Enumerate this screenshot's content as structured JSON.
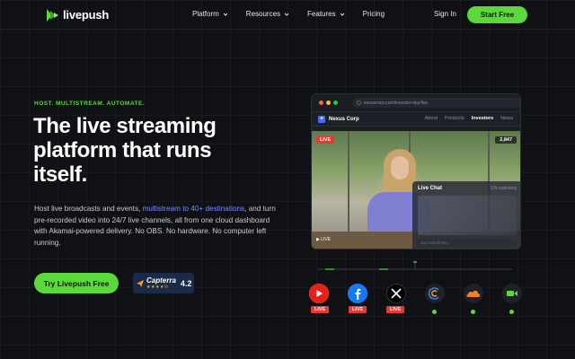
{
  "nav": {
    "logo": "livepush",
    "links": [
      "Platform",
      "Resources",
      "Features",
      "Pricing"
    ],
    "signin": "Sign In",
    "start": "Start Free"
  },
  "hero": {
    "eyebrow": "HOST. MULTISTREAM. AUTOMATE.",
    "headline": "The live streaming platform that runs itself.",
    "desc_pre": "Host live broadcasts and events, ",
    "desc_link": "multistream to 40+ destinations",
    "desc_post": ", and turn pre-recorded video into 24/7 live channels, all from one cloud dashboard with Akamai-powered delivery. No OBS. No hardware. No computer left running.",
    "cta": "Try Livepush Free",
    "capterra_name": "Capterra",
    "capterra_stars": "★★★★½",
    "capterra_score": "4.2"
  },
  "browser": {
    "url": "nexuscorp.com/investor-day/live",
    "site_name": "Nexus Corp",
    "site_nav": [
      "About",
      "Products",
      "Investors",
      "News"
    ],
    "live": "LIVE",
    "viewers": "2,847",
    "video_live": "▶  LIVE",
    "chat_title": "Live Chat",
    "chat_count": "12k watching",
    "chat_placeholder": "Say something..."
  },
  "destinations": {
    "live_label": "LIVE",
    "items": [
      "youtube",
      "facebook",
      "x",
      "akamai",
      "cloudflare",
      "video"
    ]
  },
  "colors": {
    "accent": "#5bd83c",
    "live": "#e53935",
    "link": "#7b8cff"
  }
}
